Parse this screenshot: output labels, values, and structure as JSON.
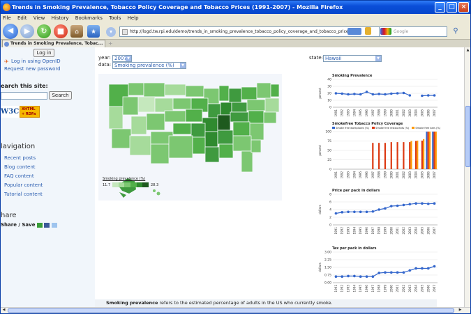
{
  "window": {
    "title": "Trends in Smoking Prevalence, Tobacco Policy Coverage and Tobacco Prices (1991-2007) - Mozilla Firefox",
    "min": "_",
    "max": "□",
    "close": "×"
  },
  "menu": [
    "File",
    "Edit",
    "View",
    "History",
    "Bookmarks",
    "Tools",
    "Help"
  ],
  "url": "http://logd.tw.rpi.edu/demo/trends_in_smoking_prevalence_tobacco_policy_coverage_and_tobacco_prices",
  "search_placeholder": "Google",
  "tab_label": "Trends in Smoking Prevalence, Tobac...",
  "sidebar": {
    "login_button": "Log in",
    "openid_link": "Log in using OpenID",
    "password_link": "Request new password",
    "search_label": "earch this site:",
    "search_button": "Search",
    "w3c_badge": "W3C",
    "rdfa_badge": "XHTML + RDFa",
    "nav_heading": "lavigation",
    "nav_items": [
      "Recent posts",
      "Blog content",
      "FAQ content",
      "Popular content",
      "Tutorial content"
    ],
    "share_heading": "hare",
    "share_button": "Share / Save"
  },
  "controls": {
    "year_label": "year:",
    "year_value": "2007",
    "data_label": "data:",
    "data_value": "Smoking prevalence (%)",
    "state_label": "state:",
    "state_value": "Hawaii"
  },
  "map_legend": {
    "title": "Smoking prevalence (%)",
    "min": "11.7",
    "max": "28.3"
  },
  "colors": {
    "accent": "#2a5db0",
    "line": "#3366cc",
    "bar_red": "#dc3912",
    "bar_orange": "#ff9900",
    "map_light": "#d9f0d3",
    "map_dark": "#1e5a1e"
  },
  "charts": [
    {
      "title": "Smoking Prevalence",
      "ylabel": "percent",
      "yticks": [
        "0",
        "10",
        "20",
        "30",
        "40"
      ],
      "ylim": [
        0,
        40
      ],
      "chart_data": {
        "type": "line",
        "x": [
          "1991",
          "1992",
          "1993",
          "1994",
          "1995",
          "1996",
          "1997",
          "1998",
          "1999",
          "2000",
          "2001",
          "2002",
          "2003",
          "2004",
          "2005",
          "2006",
          "2007"
        ],
        "series": [
          {
            "values": [
              20,
              19.5,
              18.5,
              19,
              18.5,
              22,
              18.5,
              19,
              18.5,
              19.5,
              20,
              20.5,
              17,
              null,
              16.5,
              17,
              17
            ]
          }
        ]
      }
    },
    {
      "title": "Smokefree Tobacco Policy Coverage",
      "ylabel": "percent",
      "yticks": [
        "0",
        "25",
        "50",
        "75",
        "100"
      ],
      "ylim": [
        0,
        100
      ],
      "legend": [
        "Smoke free workplaces (%)",
        "Smoke free restaurants (%)",
        "Smoke free bars (%)"
      ],
      "chart_data": {
        "type": "bar",
        "categories": [
          "1991",
          "1992",
          "1993",
          "1994",
          "1995",
          "1996",
          "1997",
          "1998",
          "1999",
          "2000",
          "2001",
          "2002",
          "2003",
          "2004",
          "2005",
          "2006",
          "2007"
        ],
        "series": [
          {
            "name": "Smoke free workplaces (%)",
            "values": [
              0,
              0,
              0,
              0,
              0,
              0,
              0,
              0,
              0,
              0,
              0,
              0,
              0,
              0,
              0,
              100,
              100
            ]
          },
          {
            "name": "Smoke free restaurants (%)",
            "values": [
              0,
              0,
              0,
              0,
              0,
              0,
              70,
              70,
              70,
              72,
              72,
              72,
              72,
              75,
              76,
              100,
              100
            ]
          },
          {
            "name": "Smoke free bars (%)",
            "values": [
              0,
              0,
              0,
              0,
              0,
              0,
              0,
              0,
              0,
              0,
              0,
              0,
              75,
              76,
              80,
              100,
              100
            ]
          }
        ]
      }
    },
    {
      "title": "Price per pack in dollars",
      "ylabel": "dollars",
      "yticks": [
        "0",
        "2",
        "4",
        "6",
        "8"
      ],
      "ylim": [
        0,
        8
      ],
      "chart_data": {
        "type": "line",
        "x": [
          "1991",
          "1992",
          "1993",
          "1994",
          "1995",
          "1996",
          "1997",
          "1998",
          "1999",
          "2000",
          "2001",
          "2002",
          "2003",
          "2004",
          "2005",
          "2006",
          "2007"
        ],
        "series": [
          {
            "values": [
              3.0,
              3.3,
              3.4,
              3.4,
              3.4,
              3.4,
              3.5,
              4.0,
              4.3,
              4.9,
              5.0,
              5.2,
              5.4,
              5.6,
              5.6,
              5.5,
              5.6
            ]
          }
        ]
      }
    },
    {
      "title": "Tax per pack in dollars",
      "ylabel": "dollars",
      "yticks": [
        "0.00",
        "0.75",
        "1.50",
        "2.25",
        "3.00"
      ],
      "ylim": [
        0,
        3
      ],
      "chart_data": {
        "type": "line",
        "x": [
          "1991",
          "1992",
          "1993",
          "1994",
          "1995",
          "1996",
          "1997",
          "1998",
          "1999",
          "2000",
          "2001",
          "2002",
          "2003",
          "2004",
          "2005",
          "2006",
          "2007"
        ],
        "series": [
          {
            "values": [
              0.6,
              0.6,
              0.65,
              0.65,
              0.6,
              0.6,
              0.6,
              0.95,
              1.0,
              1.0,
              1.0,
              1.0,
              1.2,
              1.4,
              1.4,
              1.4,
              1.6
            ]
          }
        ]
      }
    }
  ],
  "bottom": {
    "bold": "Smoking prevalence",
    "rest": " refers to the estimated percentage of adults in the US who currently smoke."
  }
}
